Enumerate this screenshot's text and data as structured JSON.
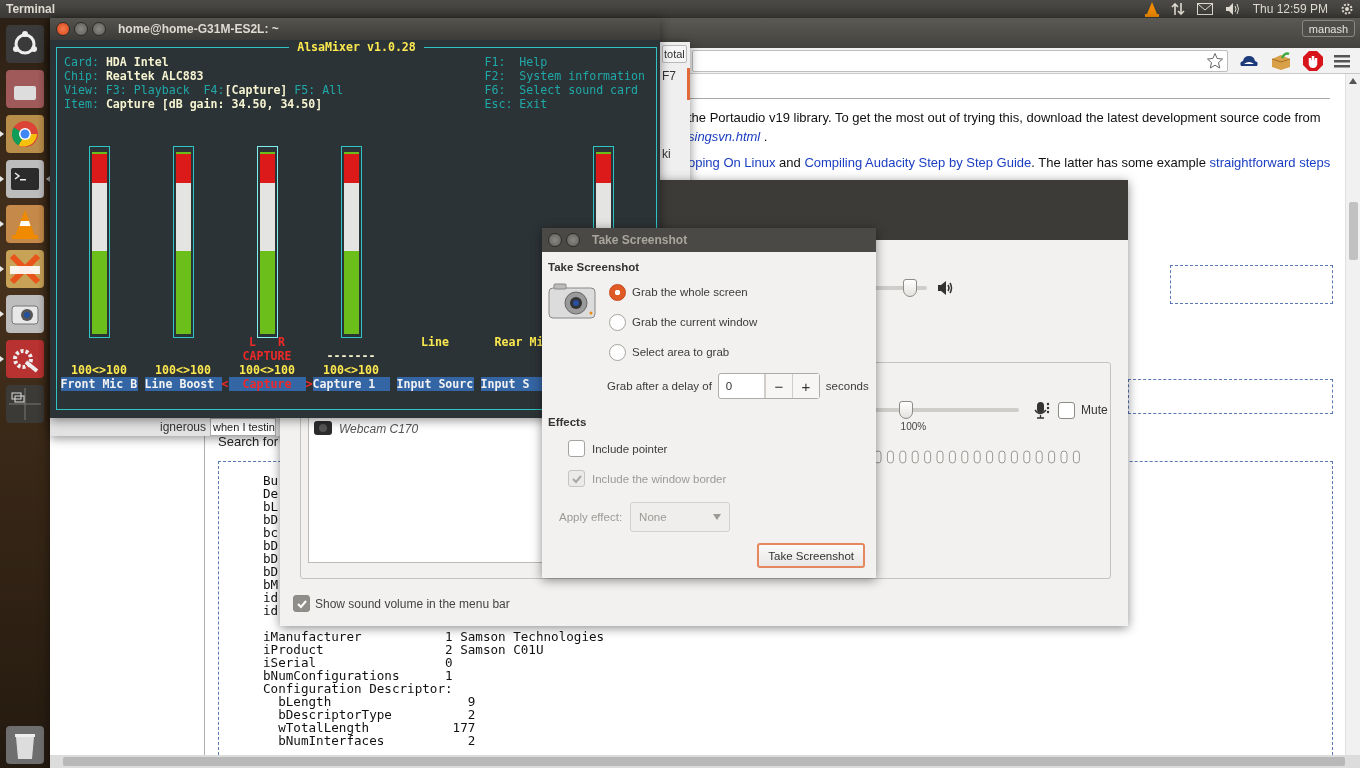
{
  "top_panel": {
    "app_title": "Terminal",
    "clock": "Thu 12:59 PM"
  },
  "launcher": [
    {
      "kind": "dash",
      "running": false,
      "focused": false
    },
    {
      "kind": "app",
      "running": false,
      "focused": false
    },
    {
      "kind": "browser",
      "running": true,
      "focused": false
    },
    {
      "kind": "terminal",
      "running": true,
      "focused": true
    },
    {
      "kind": "cone",
      "running": true,
      "focused": false
    },
    {
      "kind": "chat",
      "running": true,
      "focused": false
    },
    {
      "kind": "camera",
      "running": true,
      "focused": false
    },
    {
      "kind": "settings",
      "running": true,
      "focused": false
    },
    {
      "kind": "workspaces",
      "running": false,
      "focused": false
    },
    {
      "kind": "trash",
      "running": false,
      "focused": false
    }
  ],
  "browser": {
    "user_button": "manash",
    "paragraph_lines": [
      [
        {
          "kind": "text",
          "text": "the Portaudio v19 library. To get the most out of trying this, download the latest development source code from"
        }
      ],
      [
        {
          "kind": "italic_link",
          "text": "singsvn.html"
        },
        {
          "kind": "text",
          "text": " ."
        }
      ],
      [
        {
          "kind": "link",
          "text": "oping On Linux"
        },
        {
          "kind": "text",
          "text": " and "
        },
        {
          "kind": "link",
          "text": "Compiling Audacity Step by Step Guide"
        },
        {
          "kind": "text",
          "text": ". The latter has some example "
        },
        {
          "kind": "link",
          "text": "straightforward steps"
        }
      ]
    ],
    "search_label": "Search for",
    "code_fragments": [
      "Bu",
      "De",
      "bL",
      "bD",
      "bc",
      "bD",
      "bD",
      "bD",
      "bM",
      "id",
      "id"
    ],
    "code_lines": [
      "iManufacturer           1 Samson Technologies",
      "iProduct                2 Samson C01U",
      "iSerial                 0",
      "bNumConfigurations      1",
      "Configuration Descriptor:",
      "  bLength                  9",
      "  bDescriptorType          2",
      "  wTotalLength           177",
      "  bNumInterfaces           2"
    ]
  },
  "back_window": {
    "button": "total",
    "texts": [
      "F7",
      "ki"
    ],
    "label": "ignerous",
    "field_value": "when I testin"
  },
  "sound_settings": {
    "output_volume": {
      "level": 0.97
    },
    "device": "Webcam C170",
    "input_volume": {
      "level": 0.67
    },
    "input_percent": "100%",
    "mute_label": "Mute",
    "muted": false,
    "show_volume_label": "Show sound volume in the menu bar",
    "show_volume": true
  },
  "alsamixer": {
    "window_title": "home@home-G31M-ES2L: ~",
    "mixer_title": "AlsaMixer v1.0.28",
    "info": [
      {
        "label": "Card:",
        "value": "HDA Intel"
      },
      {
        "label": "Chip:",
        "value": "Realtek ALC883"
      }
    ],
    "view_label": "View:",
    "views": [
      {
        "key": "F3:",
        "label": "Playback",
        "selected": false
      },
      {
        "key": "F4:",
        "label": "[Capture]",
        "selected": true
      },
      {
        "key": "F5:",
        "label": "All",
        "selected": false
      }
    ],
    "item": {
      "label": "Item:",
      "value": "Capture [dB gain: 34.50, 34.50]"
    },
    "keys": [
      {
        "key": "F1:",
        "label": "Help"
      },
      {
        "key": "F2:",
        "label": "System information"
      },
      {
        "key": "F6:",
        "label": "Select sound card"
      },
      {
        "key": "Esc:",
        "label": "Exit"
      }
    ],
    "selection_markers": [
      "<",
      ">"
    ],
    "channels": [
      {
        "kind": "meter",
        "name": "Front Mic B",
        "value": "100<>100",
        "level": 1,
        "selected": false
      },
      {
        "kind": "meter",
        "name": "Line Boost",
        "value": "100<>100",
        "level": 1,
        "selected": false
      },
      {
        "kind": "meter",
        "name": "Capture",
        "value": "100<>100",
        "level": 1,
        "selected": true,
        "capture_left": "L",
        "capture_right": "R",
        "capture_label": "CAPTURE"
      },
      {
        "kind": "meter",
        "name": "Capture 1",
        "value": "100<>100",
        "level": 1,
        "selected": false,
        "switch_text": "-------"
      },
      {
        "kind": "enum",
        "name": "Input Sourc",
        "item": "Line",
        "selected": false
      },
      {
        "kind": "enum",
        "name": "Input S",
        "item": "Rear Mi",
        "selected": false
      },
      {
        "kind": "meter",
        "level": 1,
        "selected": false
      }
    ]
  },
  "screenshot_dialog": {
    "title": "Take Screenshot",
    "heading": "Take Screenshot",
    "options": [
      {
        "label": "Grab the whole screen",
        "selected": true
      },
      {
        "label": "Grab the current window",
        "selected": false
      },
      {
        "label": "Select area to grab",
        "selected": false
      }
    ],
    "delay_label": "Grab after a delay of",
    "delay_value": "0",
    "minus": "−",
    "plus": "+",
    "delay_unit": "seconds",
    "effects_heading": "Effects",
    "effects": [
      {
        "label": "Include pointer",
        "checked": false,
        "disabled": false
      },
      {
        "label": "Include the window border",
        "checked": true,
        "disabled": true
      }
    ],
    "apply_label": "Apply effect:",
    "apply_value": "None",
    "apply_disabled": true,
    "button": "Take Screenshot"
  }
}
